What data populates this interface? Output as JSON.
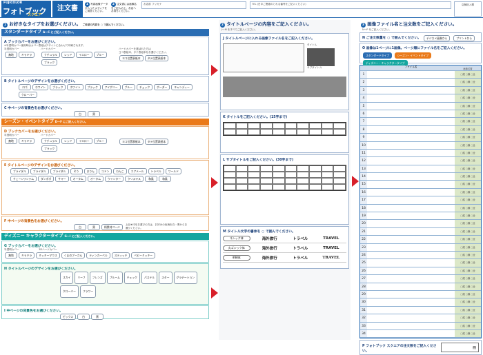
{
  "header": {
    "brand_small": "FUJICOLOR",
    "brand_big": "フォトブック",
    "brand_sub": "スクエア",
    "form_title": "注文書",
    "note1": "写真画像データが入ったメディアをご用意ください。",
    "note2": "注文書には画像名をご記入の上、お店へお持ちください。",
    "name_label": "お名前",
    "name_reading": "フリガナ",
    "tel_label": "TEL (日中ご連絡のとれる番号をご記入ください)",
    "stamp_label": "店舗記入欄"
  },
  "section1": {
    "num": "1",
    "title": "お好きなタイプをお選びください。",
    "title_note": "ご希望の内容を ○ で囲んでください。",
    "standard": {
      "band": "スタンダードタイプ",
      "band_note": "A〜C にご記入ください。",
      "cover_title": "ブックカバーをお選びください。",
      "cover_note": "※半透明カバー使用時はカバー表紙はデザインに合わせて印刷されます。",
      "semi_label": "半透明カバー",
      "semi_options": [
        "無地",
        "キラキラ"
      ],
      "hard_label": "ハードカバー",
      "hard_options": [
        "ナチュラル",
        "レッド",
        "イエロー",
        "ブルー",
        "ブラック"
      ],
      "hard_note": "ハードカバーを選ばれた方は\nヨコ表紙本、タテ表紙本をお選びください。",
      "orient_options": [
        "ヨコ位置表紙本",
        "タテ位置表紙本"
      ],
      "design_title": "タイトルページのデザインをお選びください。",
      "design_options": [
        "ロゴ",
        "ホワイト",
        "ブラック",
        "ホワイト",
        "ブラック",
        "アイボリー",
        "ブルー",
        "チェック",
        "ボーダー",
        "キャンディー",
        "クローバー"
      ],
      "bg_title": "中ページの背景色をお選びください。",
      "bg_options": [
        "白",
        "黒"
      ]
    },
    "season": {
      "band": "シーズン・イベントタイプ",
      "band_note": "D〜F にご記入ください。",
      "cover_title": "ブックカバーをお選びください。",
      "semi_label": "半透明カバー",
      "semi_options": [
        "無地",
        "キラキラ"
      ],
      "hard_label": "ハードカバー",
      "hard_options": [
        "ナチュラル",
        "レッド",
        "イエロー",
        "ブルー",
        "ブラック"
      ],
      "orient_options": [
        "ヨコ位置表紙本",
        "タテ位置表紙本"
      ],
      "design_title": "タイトルページのデザインをお選びください。",
      "design_options": [
        "ブライダル",
        "ブライダル",
        "ブライダル",
        "ぞう",
        "きりん",
        "コドン",
        "わんこ",
        "エアメール",
        "トラベル",
        "ワールド",
        "チェーンワンテム",
        "ダンボボ",
        "サマー",
        "オータム",
        "オータム",
        "ウインター",
        "クリスマス",
        "和風",
        "和風"
      ],
      "bg_title": "中ページの背景色をお選びください。",
      "bg_options": [
        "白",
        "黒",
        "柄素材ページ"
      ],
      "bg_note": "上記★印をお選びの方は、お好みの色柄を白・黒からお選びください。"
    },
    "disney": {
      "band": "ディズニー キャラクタータイプ",
      "band_note": "G〜I にご記入ください。",
      "cover_title": "ブックカバーをお選びください。",
      "semi_label": "半透明カバー",
      "hard_label": "3Dハードカバー",
      "cover_options": [
        "無地",
        "キラキラ",
        "ミッキーマウス",
        "くまのプーさん",
        "ティンカーベル",
        "スティッチ",
        "ベビーミッキー"
      ],
      "design_title": "タイトルページのデザインをお選びください。",
      "design_options": [
        "スカイ",
        "リーフ",
        "フレンズ",
        "ブルーム",
        "チェック",
        "パステル",
        "スター",
        "グラデーション",
        "クローバー",
        "フラワー"
      ],
      "bg_title": "中ページの背景色をお選びください。",
      "bg_options": [
        "ピックス",
        "白",
        "黒"
      ]
    }
  },
  "section2": {
    "num": "2",
    "title": "タイトルページの内容をご記入ください。",
    "sub_note": "J〜M をすべてご記入ください。",
    "j_title": "タイトルページに入れる画像ファイル名をご記入ください。",
    "j_label_title": "タイトル",
    "j_label_sub": "サブタイトル",
    "k_title": "タイトルをご記入ください。(15字まで)",
    "l_title": "サブタイトルをご記入ください。(30字まで)",
    "m_title": "タイトル文字の書体を ○ で囲んでください。",
    "fonts": [
      {
        "label": "ゴシック体",
        "s1": "海外旅行",
        "s2": "トラベル",
        "s3": "TRAVEL"
      },
      {
        "label": "丸ゴシック体",
        "s1": "海外旅行",
        "s2": "トラベル",
        "s3": "TRAVEL"
      },
      {
        "label": "明朝体",
        "s1": "海外旅行",
        "s2": "トラベル",
        "s3": "TRAVEL"
      }
    ]
  },
  "section3": {
    "num": "3",
    "title": "画像ファイル名と注文数をご記入ください。",
    "sub_note": "N〜P をご記入ください。",
    "n_title": "ご注文数量を ○ で囲んでください。",
    "n_options": [
      "デジカメ画像から",
      "プリントから"
    ],
    "o_title": "画像は1ページに1画像。ページ順にファイル名をご記入ください。",
    "chip_standard": "スタンダードタイプ",
    "chip_season": "シーズン・イベントタイプ",
    "chip_disney": "ディズニー・キャラクタータイプ",
    "col_file": "ファイル名",
    "col_qty": "画像位置",
    "qty_options": "□縦 □横 □全",
    "rows": [
      "1",
      "2",
      "3",
      "4",
      "5",
      "6",
      "7",
      "8",
      "9",
      "10",
      "11",
      "12",
      "13",
      "14",
      "15",
      "16",
      "17",
      "18",
      "19",
      "20",
      "21",
      "22",
      "23",
      "24",
      "25",
      "26",
      "27",
      "28",
      "29",
      "30",
      "31",
      "32",
      "33",
      "34"
    ],
    "p_title": "フォトブック スクエアの注文数をご記入ください。",
    "p_unit": "冊"
  },
  "colors": {
    "brand": "#1a63ad",
    "standard": "#2a6db3",
    "season": "#ea7a1a",
    "disney": "#14a6a0",
    "arrow": "#d8202a"
  }
}
